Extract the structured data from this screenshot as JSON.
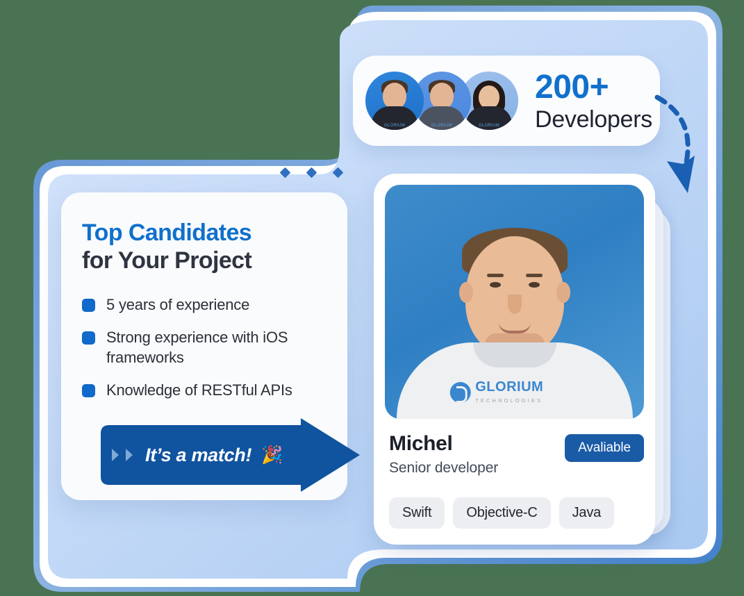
{
  "background": {
    "page_color": "#4a7354",
    "blob_color_light": "#cfe0f8",
    "blob_color_dark": "#9dc0ee"
  },
  "developers_pill": {
    "count": "200+",
    "label": "Developers",
    "avatars": [
      {
        "name": "avatar-developer-1",
        "shirt_logo": "GLORIUM",
        "bg": "#2f86de"
      },
      {
        "name": "avatar-developer-2",
        "shirt_logo": "GLORIUM",
        "bg": "#4a86dd"
      },
      {
        "name": "avatar-developer-3",
        "shirt_logo": "GLORIUM",
        "bg": "#86b1e7"
      }
    ]
  },
  "candidates_card": {
    "title_line1": "Top Candidates",
    "title_line2": "for Your Project",
    "title_color_line1": "#1170cc",
    "title_color_line2": "#2e3440",
    "requirements": [
      "5 years of experience",
      "Strong experience with iOS frameworks",
      "Knowledge of RESTful APIs"
    ],
    "match_button": {
      "label": "It’s a match!",
      "emoji": "🎉",
      "chevrons": "❯❯",
      "color": "#10539f"
    }
  },
  "profile_card": {
    "name": "Michel",
    "role": "Senior developer",
    "status": "Avaliable",
    "status_color": "#1a5ba6",
    "skills": [
      "Swift",
      "Objective-C",
      "Java"
    ],
    "photo": {
      "shirt_logo_primary": "GLORIUM",
      "shirt_logo_secondary": "TECHNOLOGIES",
      "background": "#3080c5"
    }
  },
  "decorations": {
    "diamond_count": 3,
    "diamond_color": "#2f6fc0",
    "arrow_color": "#1a5fb4"
  }
}
